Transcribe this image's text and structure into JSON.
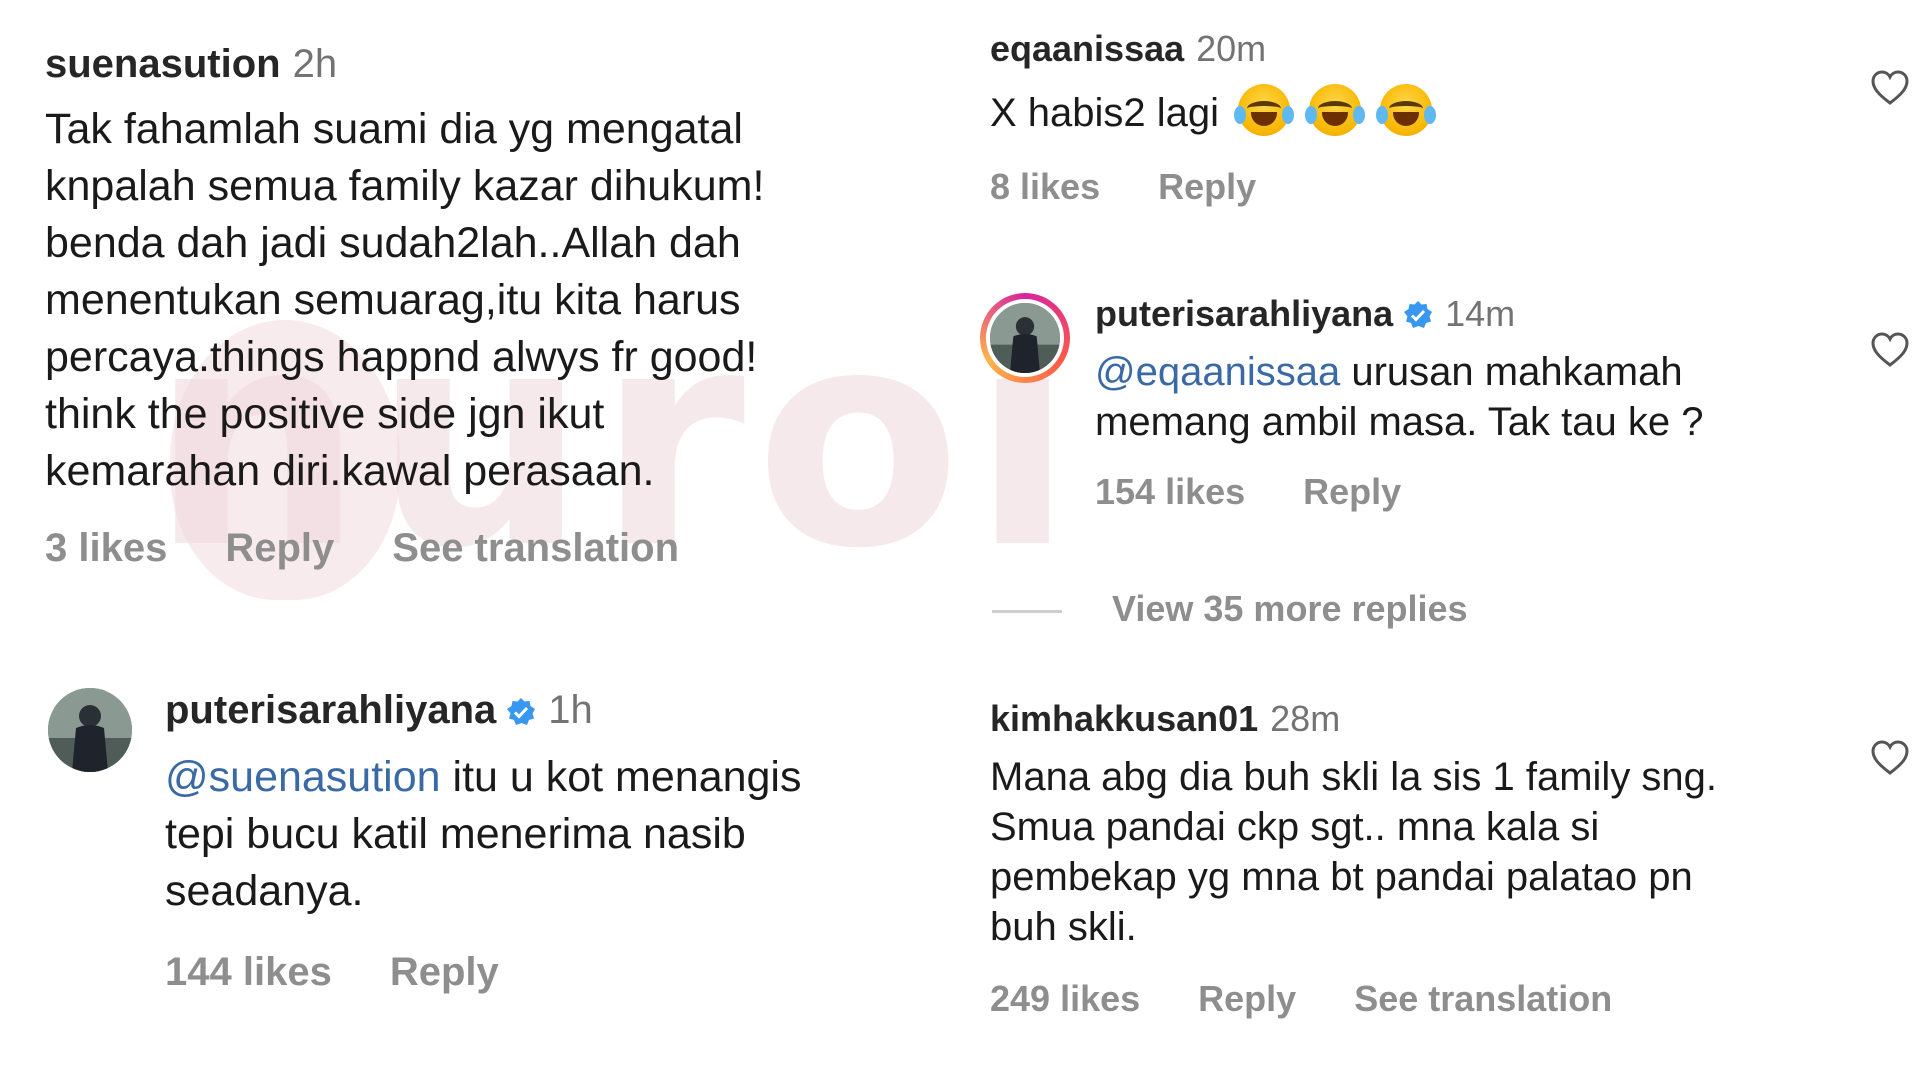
{
  "watermark": {
    "text": "nuroi"
  },
  "comments": [
    {
      "username": "suenasution",
      "time": "2h",
      "text_lines": [
        "Tak fahamlah suami dia yg mengatal",
        "knpalah semua family kazar dihukum!",
        "benda dah jadi sudah2lah..Allah dah",
        "menentukan semuarag,itu kita harus",
        "percaya.things happnd alwys fr good!",
        "think the positive side jgn ikut",
        "kemarahan diri.kawal perasaan."
      ],
      "likes": "3 likes",
      "reply": "Reply",
      "translate": "See translation"
    },
    {
      "username": "puterisarahliyana",
      "time": "1h",
      "mention": "@suenasution",
      "text_line1_rest": " itu u kot menangis",
      "text_line2": "tepi bucu katil menerima nasib",
      "text_line3": "seadanya.",
      "likes": "144 likes",
      "reply": "Reply"
    },
    {
      "username": "eqaanissaa",
      "time": "20m",
      "text": "X habis2 lagi",
      "emoji_name": "tears-of-joy",
      "likes": "8 likes",
      "reply": "Reply"
    },
    {
      "username": "puterisarahliyana",
      "time": "14m",
      "mention": "@eqaanissaa",
      "text_line1_rest": " urusan mahkamah",
      "text_line2": "memang ambil masa. Tak tau ke ?",
      "likes": "154 likes",
      "reply": "Reply",
      "view_more": "View 35 more replies"
    },
    {
      "username": "kimhakkusan01",
      "time": "28m",
      "text_lines": [
        "Mana abg dia buh skli la sis 1 family sng.",
        "Smua pandai ckp sgt.. mna kala si",
        "pembekap yg mna bt pandai palatao pn",
        "buh skli."
      ],
      "likes": "249 likes",
      "reply": "Reply",
      "translate": "See translation"
    }
  ],
  "colors": {
    "mention": "#3a6aa6",
    "verified": "#3897f0",
    "muted": "#8e8e8e"
  },
  "icons": {
    "heart": "heart-outline-icon",
    "verified": "verified-badge-icon"
  }
}
